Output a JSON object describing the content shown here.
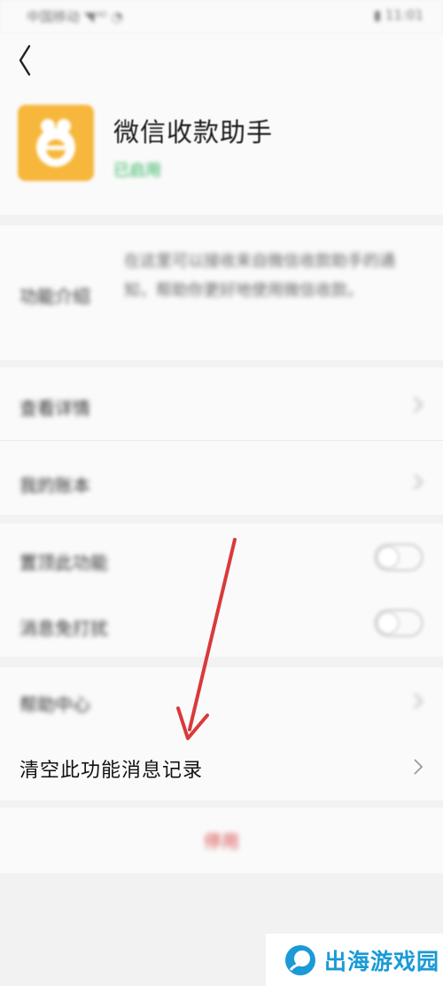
{
  "status_bar": {
    "left": "中国移动 ◥ᴴᴰ ◔",
    "right": "▮ 11:01"
  },
  "header": {
    "app_name": "微信收款助手",
    "status": "已启用"
  },
  "intro": {
    "label": "功能介绍",
    "description": "在这里可以接收来自微信收款助手的通知，帮助你更好地使用微信收款。"
  },
  "menu_group_1": [
    {
      "label": "查看详情"
    },
    {
      "label": "我的账本"
    }
  ],
  "toggle_group": [
    {
      "label": "置顶此功能",
      "on": false
    },
    {
      "label": "消息免打扰",
      "on": false
    }
  ],
  "menu_group_2": [
    {
      "label": "帮助中心"
    },
    {
      "label": "清空此功能消息记录"
    }
  ],
  "stop_button": {
    "label": "停用"
  },
  "watermark": {
    "text": "出海游戏园"
  },
  "colors": {
    "accent_green": "#29b35a",
    "app_icon": "#f6b73c",
    "danger": "#d94b4b",
    "annotation": "#d93a3a",
    "watermark": "#1a9ad6"
  }
}
